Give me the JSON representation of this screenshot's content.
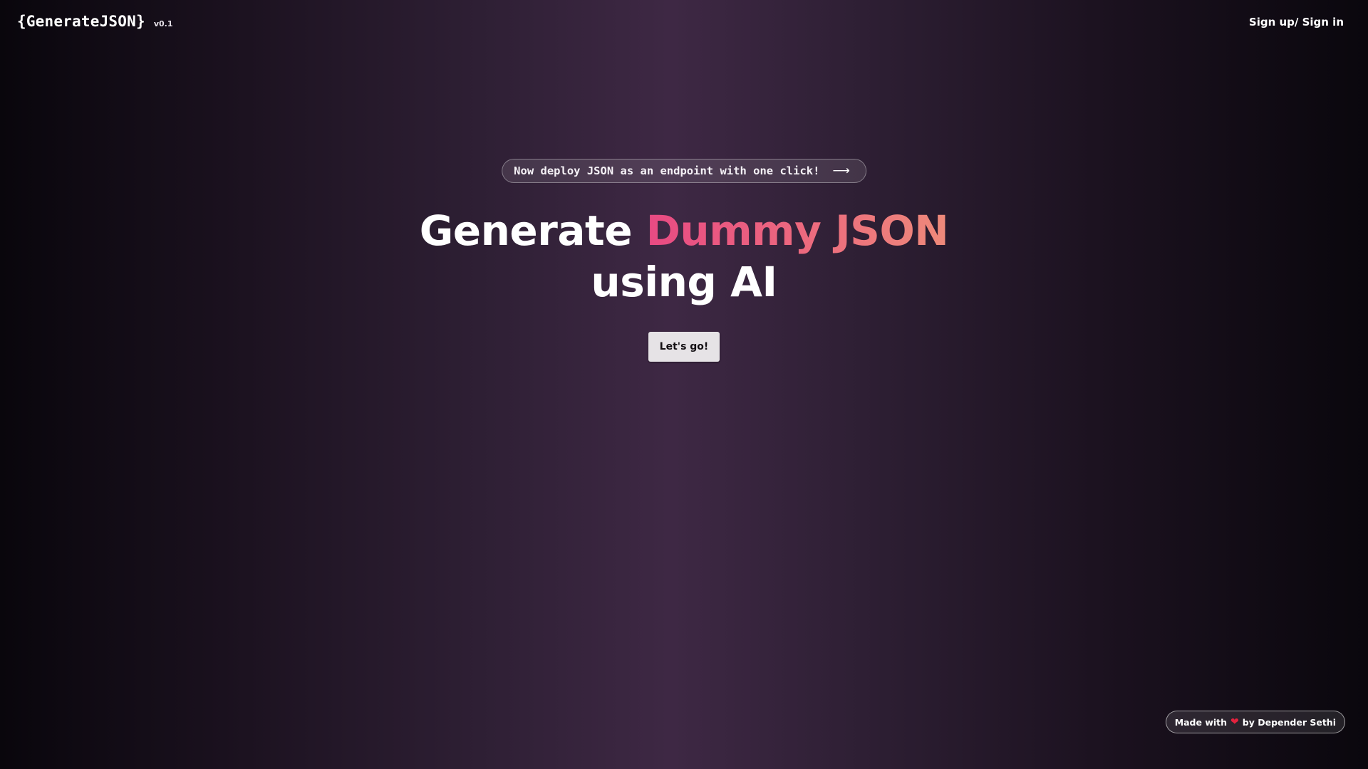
{
  "header": {
    "logo": "{GenerateJSON}",
    "version": "v0.1",
    "auth_link": "Sign up/ Sign in"
  },
  "announcement": {
    "text": "Now deploy JSON as an endpoint with one click!",
    "icon": "arrow-right-icon"
  },
  "hero": {
    "title_prefix": "Generate",
    "title_accent": "Dummy JSON",
    "title_suffix": "using AI"
  },
  "cta": {
    "label": "Let's go!"
  },
  "footer_badge": {
    "prefix": "Made with",
    "icon": "heart-icon",
    "suffix": "by Depender Sethi"
  },
  "colors": {
    "accent_start": "#e84a83",
    "accent_end": "#ee8a7a",
    "background_center": "#3e2844",
    "background_edge": "#09060c",
    "heart": "#e5223e"
  }
}
